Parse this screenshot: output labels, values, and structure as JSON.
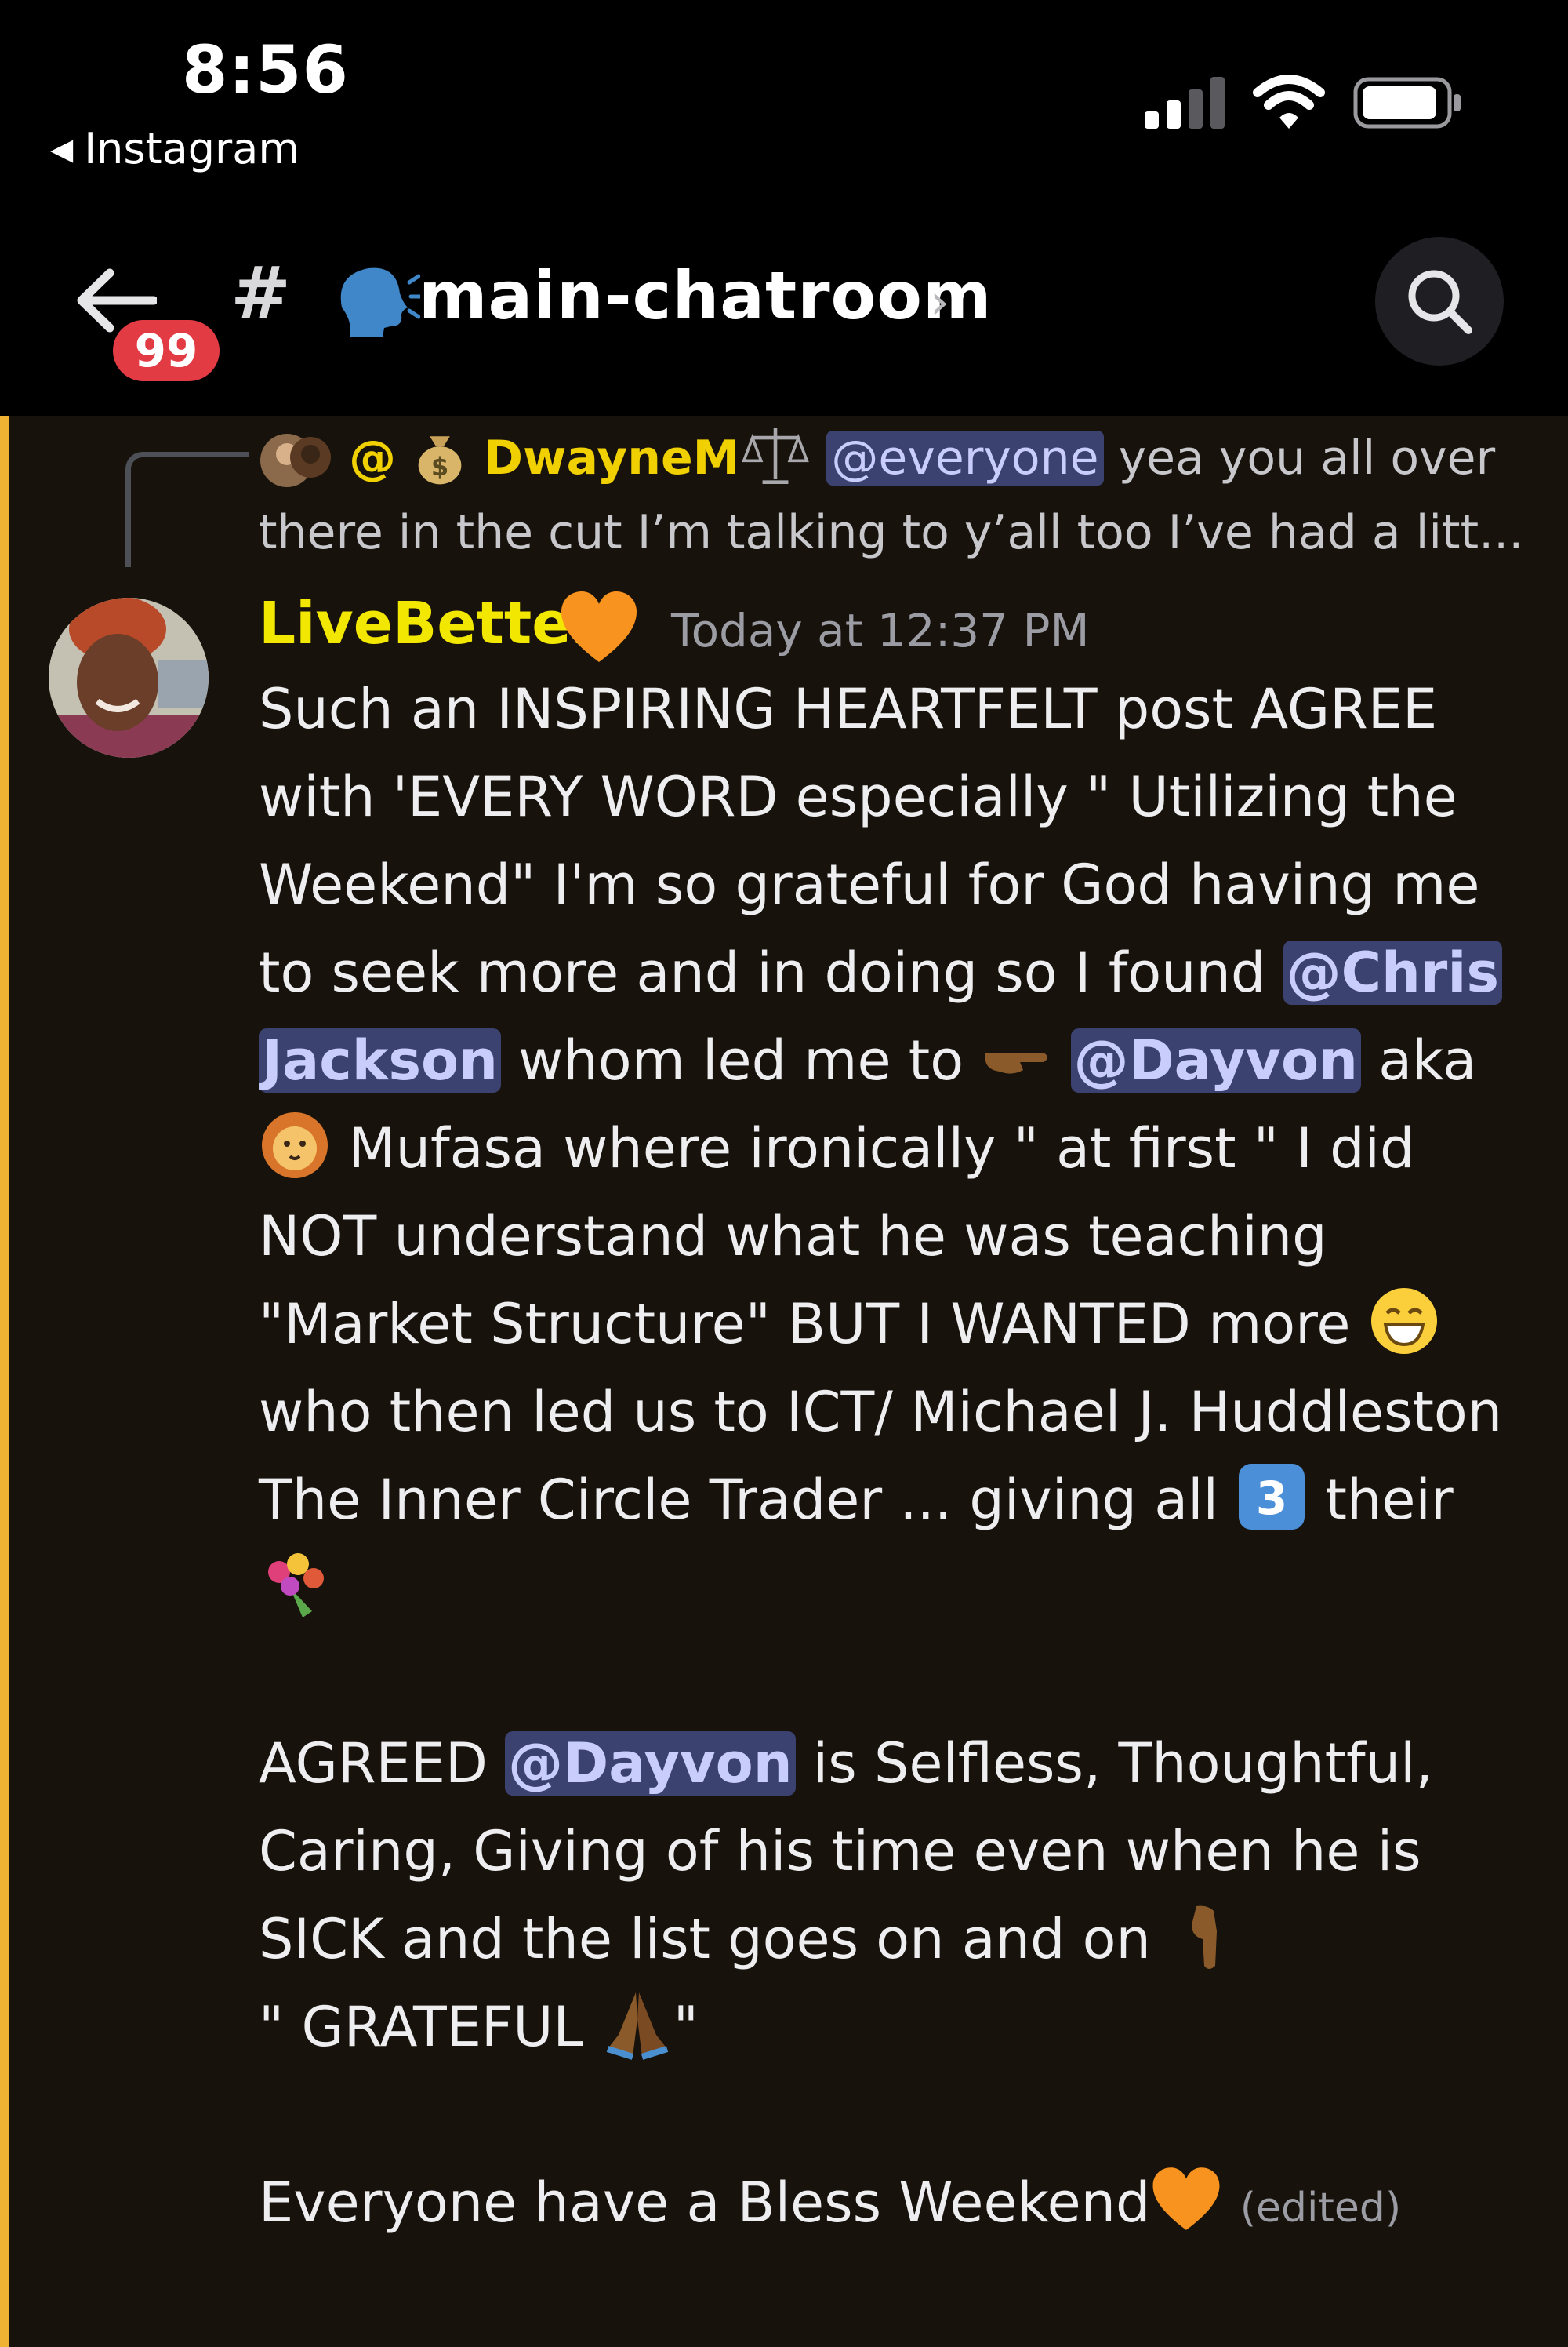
{
  "status_bar": {
    "time": "8:56",
    "back_app": "Instagram"
  },
  "header": {
    "unread_badge": "99",
    "hash": "#",
    "channel_name": "main-chatroom",
    "chevron": "›"
  },
  "reply": {
    "at": "@",
    "author": "DwayneM",
    "mention": "@everyone",
    "text_a": " yea you all over",
    "text_b": "there in the cut I’m talking to y’all too I’ve had a litt..."
  },
  "message": {
    "author": "LiveBetter",
    "timestamp": "Today at 12:37 PM",
    "l1": "Such an INSPIRING HEARTFELT post AGREE",
    "l2": "with 'EVERY WORD especially \" Utilizing the",
    "l3": "Weekend\"  I'm so grateful for God having me",
    "l4a": "to seek more and in doing so  I found ",
    "m_chris_a": "@Chris",
    "m_chris_b": "Jackson",
    "l5a": "  whom led me to ",
    "m_dayvon": "@Dayvon",
    "l5b": "  aka",
    "l6": " Mufasa  where ironically \" at first \" I did",
    "l7": "NOT understand what he was teaching",
    "l8": "\"Market Structure\" BUT I WANTED more ",
    "l9": "who then led us to ICT/ Michael J. Huddleston",
    "l10a": "The Inner Circle Trader ... giving all ",
    "l10b": " their",
    "l12a": " AGREED ",
    "l12b": "  is Selfless, Thoughtful,",
    "l13": "Caring, Giving of his time even when he is",
    "l14": "SICK and the list goes on and on  ",
    "l15a": "\" GRATEFUL ",
    "l15b": "\"",
    "l17": "Everyone have a Bless Weekend",
    "edited": "(edited)"
  },
  "colors": {
    "background": "#17120b",
    "accent_bar": "#f0b232",
    "username": "#f2e700",
    "mention_bg": "#3c4270",
    "badge": "#e23b44"
  },
  "icons": [
    "back-arrow-icon",
    "search-icon",
    "speaking-head-icon",
    "orange-heart-icon",
    "money-bag-icon",
    "scales-icon",
    "pointing-right-icon",
    "lion-icon",
    "grin-icon",
    "keycap-3-icon",
    "bouquet-icon",
    "pointing-down-icon",
    "praying-hands-icon",
    "signal-icon",
    "wifi-icon",
    "battery-icon"
  ]
}
